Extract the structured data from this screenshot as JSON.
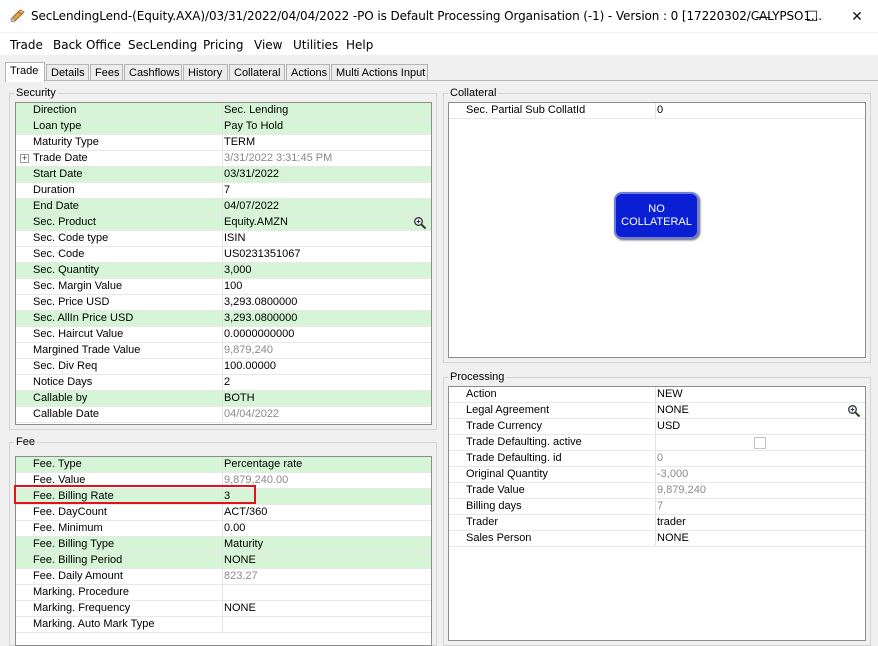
{
  "window": {
    "title": "SecLendingLend-(Equity.AXA)/03/31/2022/04/04/2022  -PO is Default Processing Organisation  (-1) - Version : 0  [17220302/CALYPSO1...",
    "minimize": "—",
    "maximize": "☐",
    "close": "✕"
  },
  "menu": [
    "Trade",
    "Back Office",
    "SecLending",
    "Pricing",
    "View",
    "Utilities",
    "Help"
  ],
  "tabs": [
    "Trade",
    "Details",
    "Fees",
    "Cashflows",
    "History",
    "Collateral",
    "Actions",
    "Multi Actions Input"
  ],
  "security": {
    "label": "Security",
    "rows": [
      {
        "k": "Direction",
        "v": "Sec. Lending",
        "hl": true
      },
      {
        "k": "Loan type",
        "v": "Pay To Hold",
        "hl": true
      },
      {
        "k": "Maturity Type",
        "v": "TERM"
      },
      {
        "k": "Trade Date",
        "v": "3/31/2022 3:31:45 PM",
        "gray": true,
        "expander": "+"
      },
      {
        "k": "Start Date",
        "v": "03/31/2022",
        "hl": true
      },
      {
        "k": "Duration",
        "v": "7"
      },
      {
        "k": "End Date",
        "v": "04/07/2022",
        "hl": true
      },
      {
        "k": "Sec. Product",
        "v": "Equity.AMZN",
        "hl": true,
        "icon": "magnifier-icon"
      },
      {
        "k": "Sec. Code type",
        "v": "ISIN"
      },
      {
        "k": "Sec. Code",
        "v": "US0231351067"
      },
      {
        "k": "Sec. Quantity",
        "v": "3,000",
        "hl": true
      },
      {
        "k": "Sec. Margin Value",
        "v": "100"
      },
      {
        "k": "Sec. Price USD",
        "v": "3,293.0800000"
      },
      {
        "k": "Sec. AllIn Price USD",
        "v": "3,293.0800000",
        "hl": true
      },
      {
        "k": "Sec. Haircut Value",
        "v": "0.0000000000"
      },
      {
        "k": "Margined Trade Value",
        "v": "9,879,240",
        "gray": true
      },
      {
        "k": "Sec. Div Req",
        "v": "100.00000"
      },
      {
        "k": "Notice Days",
        "v": "2"
      },
      {
        "k": "Callable by",
        "v": "BOTH",
        "hl": true
      },
      {
        "k": "Callable Date",
        "v": "04/04/2022",
        "gray": true
      }
    ]
  },
  "fee": {
    "label": "Fee",
    "rows": [
      {
        "k": "Fee. Type",
        "v": "Percentage rate",
        "hl": true
      },
      {
        "k": "Fee. Value",
        "v": "9,879,240.00",
        "gray": true
      },
      {
        "k": "Fee. Billing Rate",
        "v": "3",
        "hl": true
      },
      {
        "k": "Fee. DayCount",
        "v": "ACT/360"
      },
      {
        "k": "Fee. Minimum",
        "v": "0.00"
      },
      {
        "k": "Fee. Billing Type",
        "v": "Maturity",
        "hl": true
      },
      {
        "k": "Fee. Billing Period",
        "v": "NONE",
        "hl": true
      },
      {
        "k": "Fee. Daily Amount",
        "v": "823.27",
        "gray": true
      },
      {
        "k": "Marking. Procedure",
        "v": ""
      },
      {
        "k": "Marking. Frequency",
        "v": "NONE"
      },
      {
        "k": "Marking. Auto Mark Type",
        "v": ""
      }
    ]
  },
  "collateral": {
    "label": "Collateral",
    "rows": [
      {
        "k": "Sec. Partial Sub CollatId",
        "v": "0"
      }
    ],
    "no_collateral_line1": "NO",
    "no_collateral_line2": "COLLATERAL"
  },
  "processing": {
    "label": "Processing",
    "rows": [
      {
        "k": "Action",
        "v": "NEW"
      },
      {
        "k": "Legal Agreement",
        "v": "NONE",
        "icon": "magnifier-icon"
      },
      {
        "k": "Trade Currency",
        "v": "USD"
      },
      {
        "k": "Trade Defaulting. active",
        "v": "",
        "checkbox": true
      },
      {
        "k": "Trade Defaulting. id",
        "v": "0",
        "gray": true
      },
      {
        "k": "Original Quantity",
        "v": "-3,000",
        "gray": true
      },
      {
        "k": "Trade Value",
        "v": "9,879,240",
        "gray": true
      },
      {
        "k": "Billing days",
        "v": "7",
        "gray": true
      },
      {
        "k": "Trader",
        "v": "trader"
      },
      {
        "k": "Sales Person",
        "v": "NONE"
      }
    ]
  },
  "colors": {
    "highlight_row": "#d6f5d6",
    "no_collateral": "#0a1fd4",
    "red_outline": "#e0121b"
  }
}
